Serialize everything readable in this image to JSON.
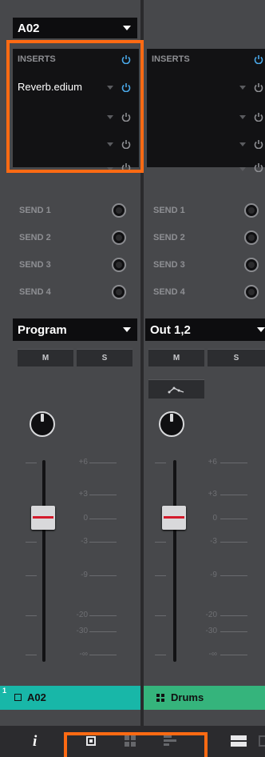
{
  "tracks": [
    {
      "name": "A02",
      "inserts_header": "INSERTS",
      "inserts": [
        "Reverb.edium",
        "",
        "",
        ""
      ],
      "sends": [
        "SEND 1",
        "SEND 2",
        "SEND 3",
        "SEND 4"
      ],
      "output": "Program",
      "mute_label": "M",
      "solo_label": "S",
      "scale": [
        "+6",
        "+3",
        "0",
        "-3",
        "-9",
        "-20",
        "-30",
        "-∞"
      ],
      "footer_index": "1",
      "footer_label": "A02",
      "footer_color": "#18b7a8"
    },
    {
      "name": "",
      "inserts_header": "INSERTS",
      "inserts": [
        "",
        "",
        "",
        ""
      ],
      "sends": [
        "SEND 1",
        "SEND 2",
        "SEND 3",
        "SEND 4"
      ],
      "output": "Out 1,2",
      "mute_label": "M",
      "solo_label": "S",
      "scale": [
        "+6",
        "+3",
        "0",
        "-3",
        "-9",
        "-20",
        "-30",
        "-∞"
      ],
      "footer_label": "Drums",
      "footer_color": "#35b47c"
    }
  ],
  "toolbar": {
    "info_label": "i",
    "icons": [
      "info-icon",
      "single-view-icon",
      "grid-view-icon",
      "list-view-icon",
      "strip-view-icon"
    ]
  },
  "colors": {
    "highlight": "#ff6a13",
    "power_on": "#4aa8e8",
    "fader_mark": "#d41b2c"
  }
}
